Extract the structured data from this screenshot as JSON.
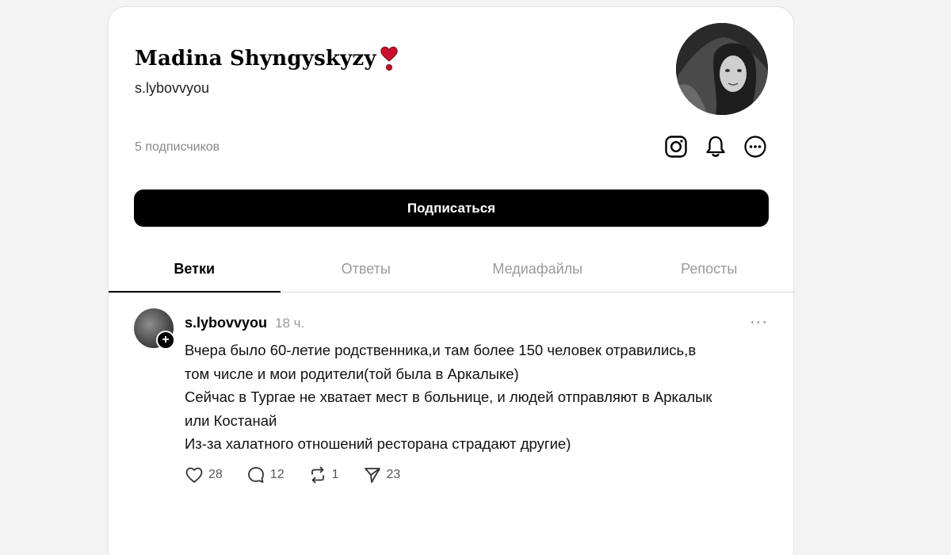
{
  "profile": {
    "display_name": "Madina Shyngyskyzy",
    "handle": "s.lybovvyou",
    "followers": "5 подписчиков",
    "follow_label": "Подписаться"
  },
  "tabs": [
    {
      "label": "Ветки",
      "active": true
    },
    {
      "label": "Ответы",
      "active": false
    },
    {
      "label": "Медиафайлы",
      "active": false
    },
    {
      "label": "Репосты",
      "active": false
    }
  ],
  "post": {
    "author": "s.lybovvyou",
    "time": "18 ч.",
    "more": "···",
    "lines": [
      "Вчера было 60-летие родственника,и там более 150 человек отравились,в",
      "том числе и мои родители(той была в Аркалыке)",
      "Сейчас в Тургае не хватает мест в больнице, и людей отправляют в Аркалык",
      "или Костанай",
      "Из-за халатного отношений ресторана страдают другие)"
    ],
    "likes": "28",
    "replies": "12",
    "reposts": "1",
    "shares": "23"
  },
  "icons": {
    "heart_emoji": "heart-exclamation-icon",
    "instagram": "instagram-icon",
    "bell": "bell-icon",
    "more": "more-circle-icon"
  },
  "colors": {
    "accent": "#000000",
    "emoji_red": "#c8102e",
    "muted_text": "#9a9a9a"
  }
}
